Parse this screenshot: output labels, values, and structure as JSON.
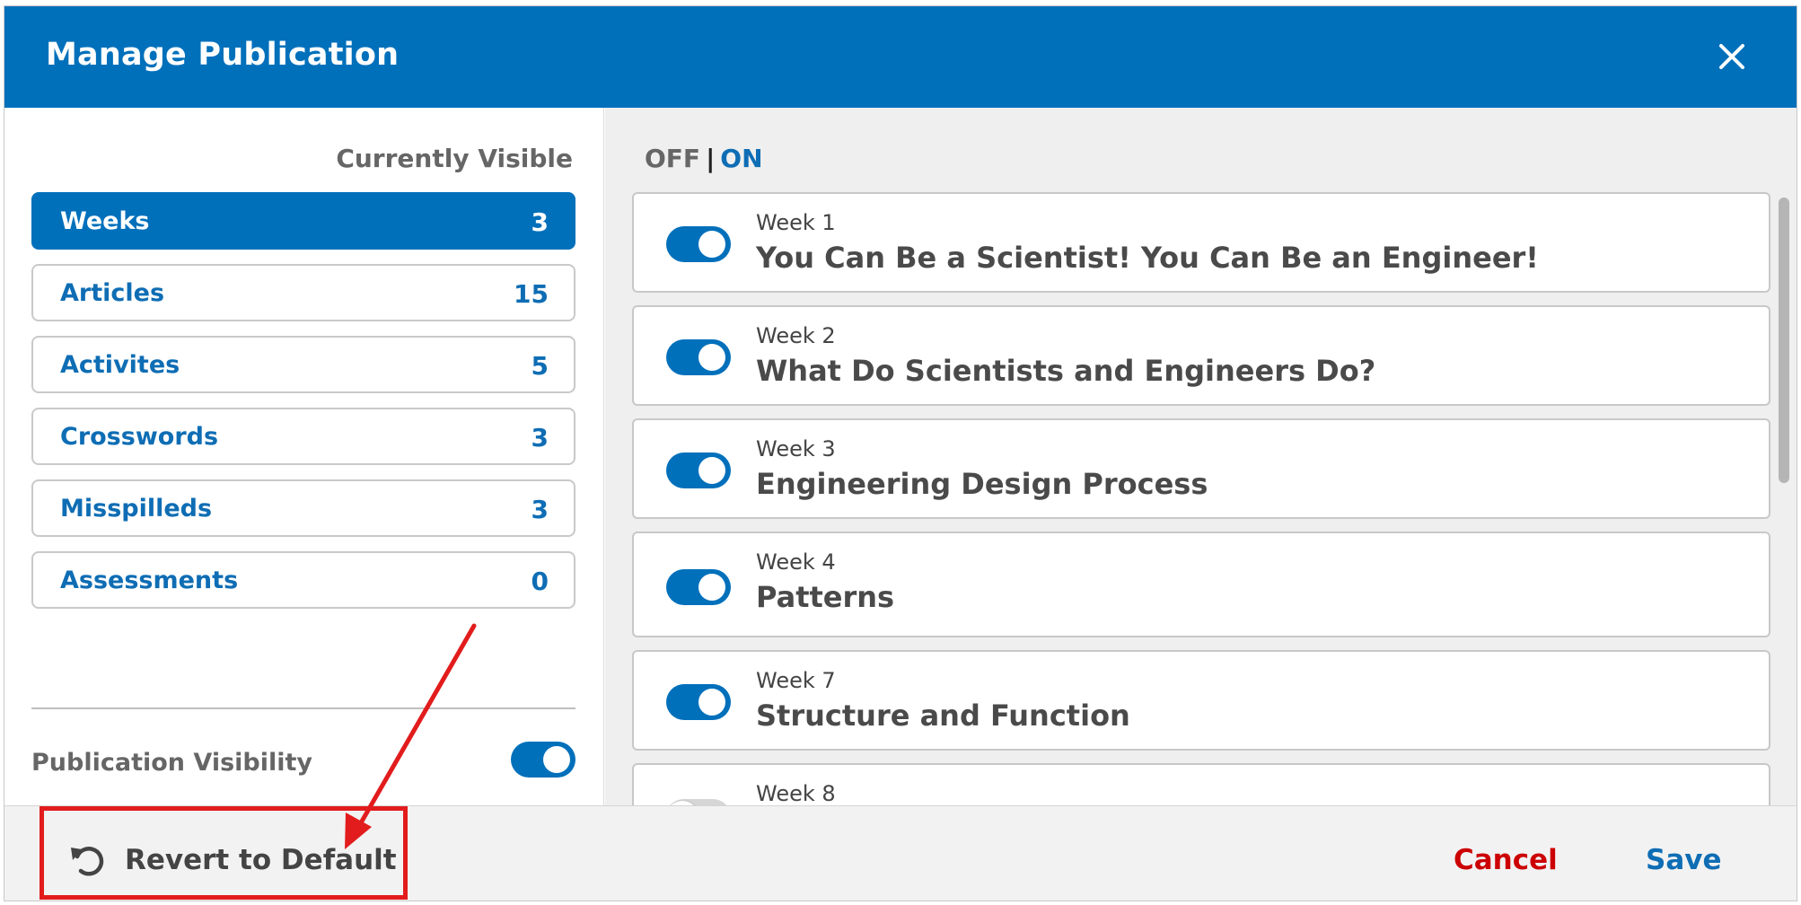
{
  "dialog": {
    "title": "Manage Publication",
    "close_icon": "close-icon"
  },
  "sidebar": {
    "header": "Currently Visible",
    "categories": [
      {
        "label": "Weeks",
        "count": "3",
        "active": true
      },
      {
        "label": "Articles",
        "count": "15",
        "active": false
      },
      {
        "label": "Activites",
        "count": "5",
        "active": false
      },
      {
        "label": "Crosswords",
        "count": "3",
        "active": false
      },
      {
        "label": "Misspilleds",
        "count": "3",
        "active": false
      },
      {
        "label": "Assessments",
        "count": "0",
        "active": false
      }
    ],
    "publication_visibility_label": "Publication Visibility",
    "publication_visibility_on": true
  },
  "content": {
    "off_label": "OFF",
    "separator": "|",
    "on_label": "ON",
    "weeks": [
      {
        "number": "Week 1",
        "title": "You Can Be a Scientist! You Can Be an Engineer!",
        "on": true
      },
      {
        "number": "Week 2",
        "title": "What Do Scientists and Engineers Do?",
        "on": true
      },
      {
        "number": "Week 3",
        "title": "Engineering Design Process",
        "on": true
      },
      {
        "number": "Week 4",
        "title": "Patterns",
        "on": true
      },
      {
        "number": "Week 7",
        "title": "Structure and Function",
        "on": true
      },
      {
        "number": "Week 8",
        "title": "",
        "on": false
      }
    ]
  },
  "footer": {
    "revert_label": "Revert to Default",
    "revert_icon": "undo-icon",
    "cancel_label": "Cancel",
    "save_label": "Save"
  },
  "colors": {
    "brand_blue": "#0170bb",
    "cancel_red": "#cc0000",
    "annotation_red": "#e21c1c"
  }
}
